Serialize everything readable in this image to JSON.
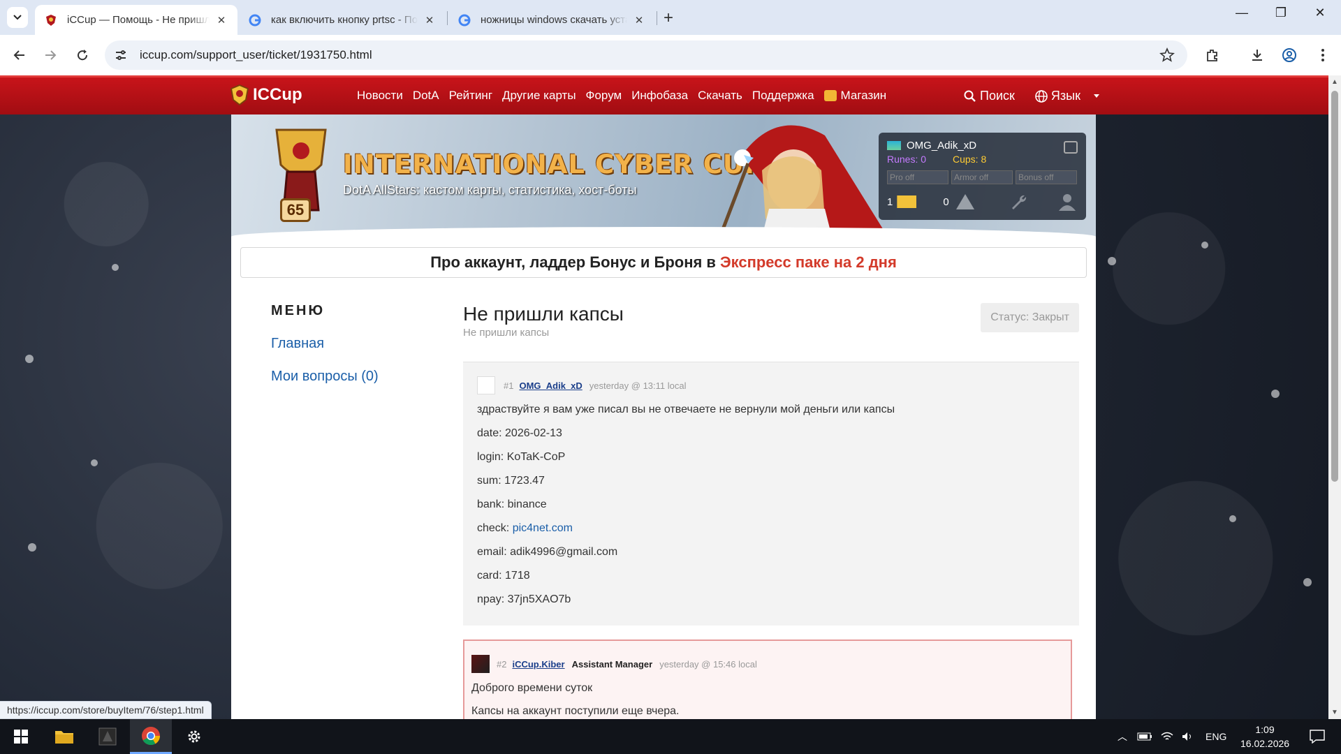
{
  "browser": {
    "tabs": [
      {
        "title": "iCCup — Помощь - Не пришли капсы",
        "close": "✕"
      },
      {
        "title": "как включить кнопку prtsc - Поиск в Google",
        "close": "✕"
      },
      {
        "title": "ножницы windows скачать установить",
        "close": "✕"
      }
    ],
    "new_tab": "+",
    "url": "iccup.com/support_user/ticket/1931750.html",
    "status_url": "https://iccup.com/store/buyItem/76/step1.html",
    "window_controls": {
      "minimize": "—",
      "maximize": "❐",
      "close": "✕"
    }
  },
  "site": {
    "logo": "ICCup",
    "nav": [
      "Новости",
      "DotA",
      "Рейтинг",
      "Другие карты",
      "Форум",
      "Инфобаза",
      "Скачать",
      "Поддержка"
    ],
    "shop": "Магазин",
    "search": "Поиск",
    "language": "Язык"
  },
  "banner": {
    "title": "INTERNATIONAL CYBER CUP",
    "subtitle": "DotA AllStars: кастом карты, статистика, хост-боты",
    "level": "65"
  },
  "user": {
    "name": "OMG_Adik_xD",
    "runes": "Runes: 0",
    "cups": "Cups: 8",
    "toggles": [
      "Pro off",
      "Armor off",
      "Bonus off"
    ],
    "messages": "1",
    "warnings": "0"
  },
  "promo": {
    "text": "Про аккаунт, ладдер Бонус и Броня в",
    "highlight": "Экспресс паке на 2 дня"
  },
  "sidebar": {
    "title": "МЕНЮ",
    "items": [
      "Главная",
      "Мои вопросы (0)"
    ]
  },
  "ticket": {
    "title": "Не пришли капсы",
    "subtitle": "Не пришли капсы",
    "status": "Статус: Закрыт"
  },
  "messages": [
    {
      "num": "#1",
      "author": "OMG_Adik_xD",
      "time": "yesterday @ 13:11 local",
      "lines": [
        "здраствуйте я вам уже писал вы не отвечаете не вернули мой деньги или капсы",
        "date: 2026-02-13",
        "login: KoTaK-CoP",
        "sum: 1723.47",
        "bank: binance",
        "email: adik4996@gmail.com",
        "card: 1718",
        "npay: 37jn5XAO7b"
      ],
      "check_label": "check: ",
      "check_link": "pic4net.com"
    },
    {
      "num": "#2",
      "author": "iCCup.Kiber",
      "role": "Assistant Manager",
      "time": "yesterday @ 15:46 local",
      "lines": [
        "Доброго времени суток",
        "Капсы на аккаунт поступили еще вчера."
      ]
    }
  ],
  "taskbar": {
    "lang": "ENG",
    "time": "1:09",
    "date": "16.02.2026"
  }
}
